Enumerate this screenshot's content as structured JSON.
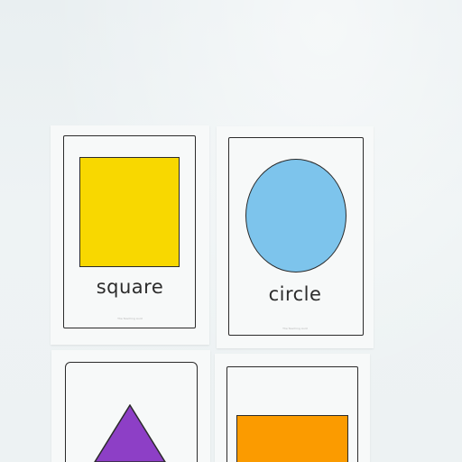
{
  "cards": [
    {
      "label": "square",
      "shape": "square",
      "color": "#f8d800",
      "footer": "The Teaching Aunt"
    },
    {
      "label": "circle",
      "shape": "circle",
      "color": "#7dc4ec",
      "footer": "The Teaching Aunt"
    },
    {
      "label": "",
      "shape": "triangle",
      "color": "#8d3fc6",
      "footer": ""
    },
    {
      "label": "",
      "shape": "rectangle",
      "color": "#fb9b00",
      "footer": ""
    }
  ],
  "background_color": "#eaf0f1"
}
